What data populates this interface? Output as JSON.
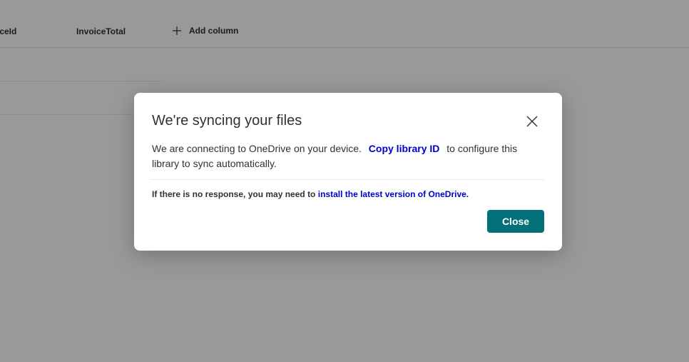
{
  "list": {
    "columns": [
      "iceId",
      "InvoiceTotal"
    ],
    "add_column_label": "Add column",
    "add_column_icon": "plus-icon"
  },
  "dialog": {
    "title": "We're syncing your files",
    "close_icon": "close-icon",
    "body_before": "We are connecting to OneDrive on your device.",
    "copy_link_label": "Copy library ID",
    "body_after": "to configure this library to sync automatically.",
    "note_text": "If there is no response, you may need to",
    "note_link": "install the latest version of OneDrive.",
    "close_button_label": "Close"
  },
  "colors": {
    "accent": "#037079",
    "link": "#0000cc",
    "text": "#323130"
  }
}
